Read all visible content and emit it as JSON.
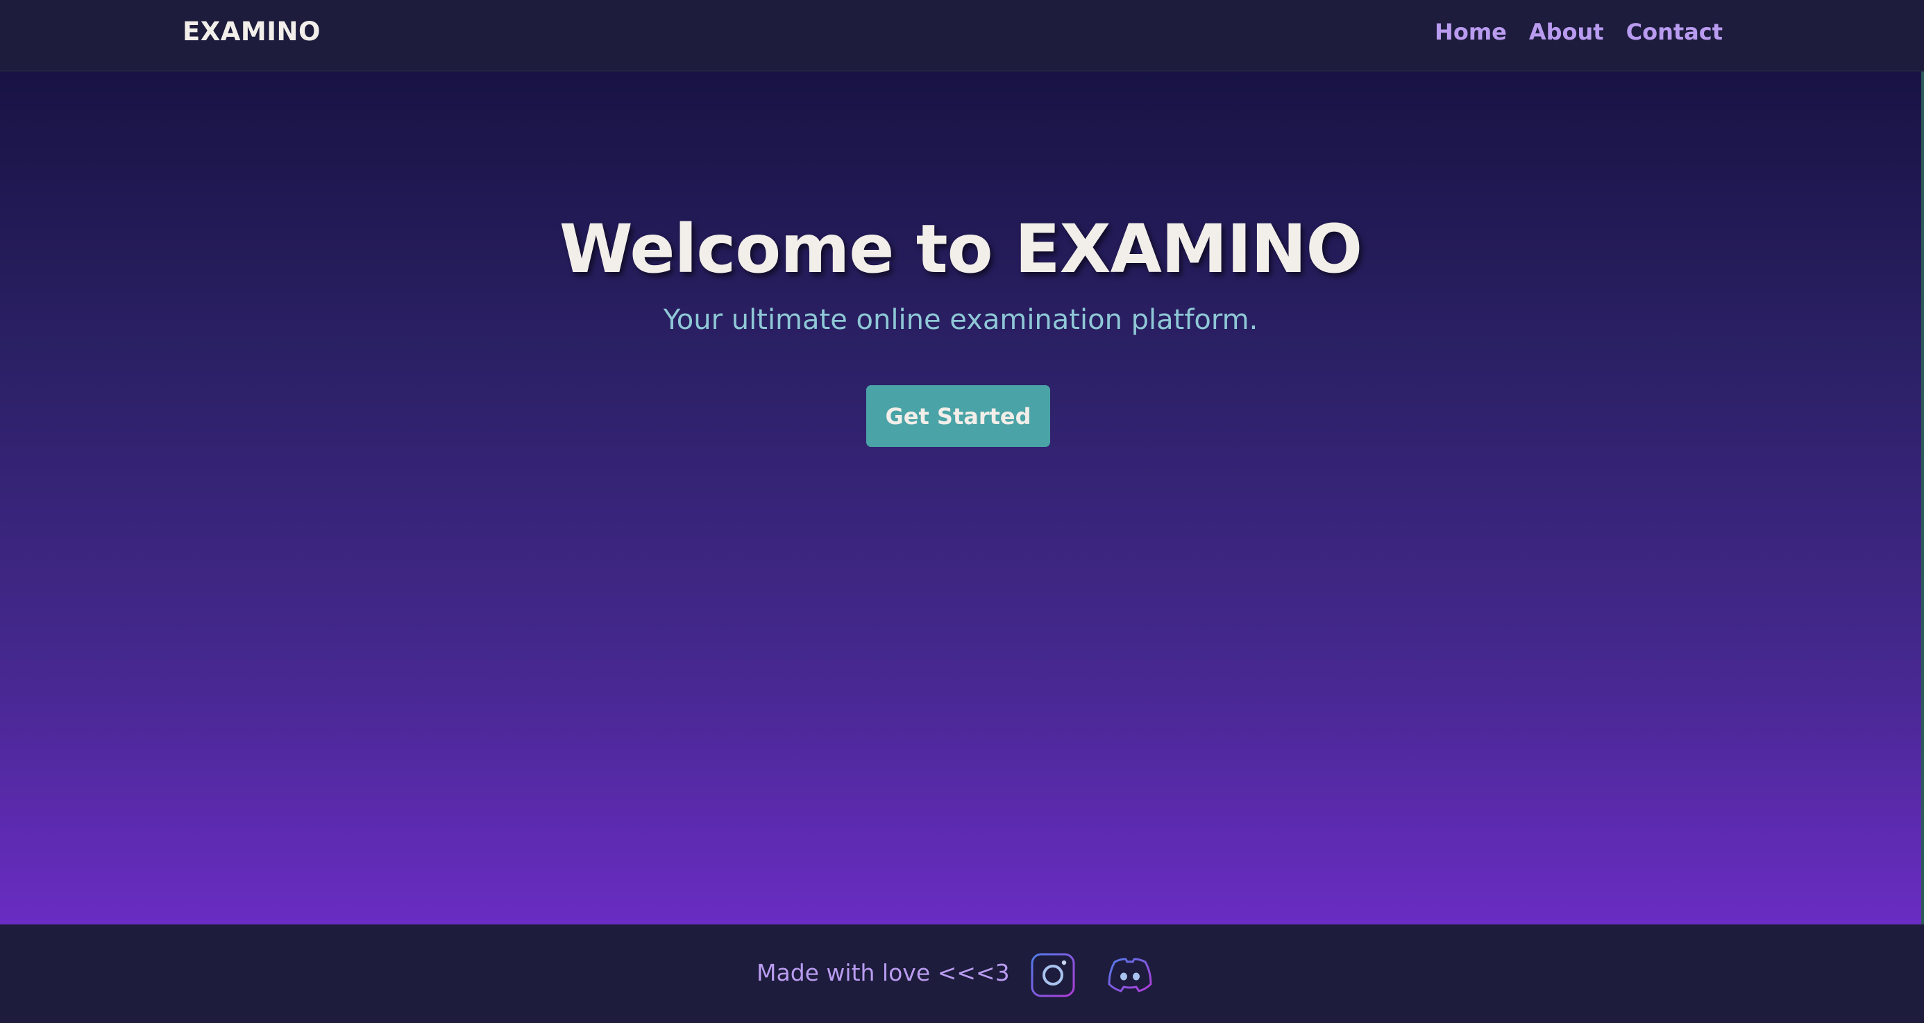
{
  "header": {
    "brand": "EXAMINO",
    "nav": [
      {
        "label": "Home"
      },
      {
        "label": "About"
      },
      {
        "label": "Contact"
      }
    ]
  },
  "hero": {
    "title": "Welcome to EXAMINO",
    "subtitle": "Your ultimate online examination platform.",
    "cta_label": "Get Started"
  },
  "footer": {
    "text": "Made with love <<<3",
    "social_icons": [
      "instagram-icon",
      "discord-icon"
    ]
  },
  "colors": {
    "header_bg": "#1d1c3c",
    "brand_text": "#f2eee9",
    "nav_link": "#b99cf0",
    "hero_gradient_top": "#181344",
    "hero_gradient_bottom": "#6a2cc3",
    "subtitle": "#8fc8d6",
    "cta_bg": "#4aa3a6",
    "footer_text": "#b99cf0"
  }
}
